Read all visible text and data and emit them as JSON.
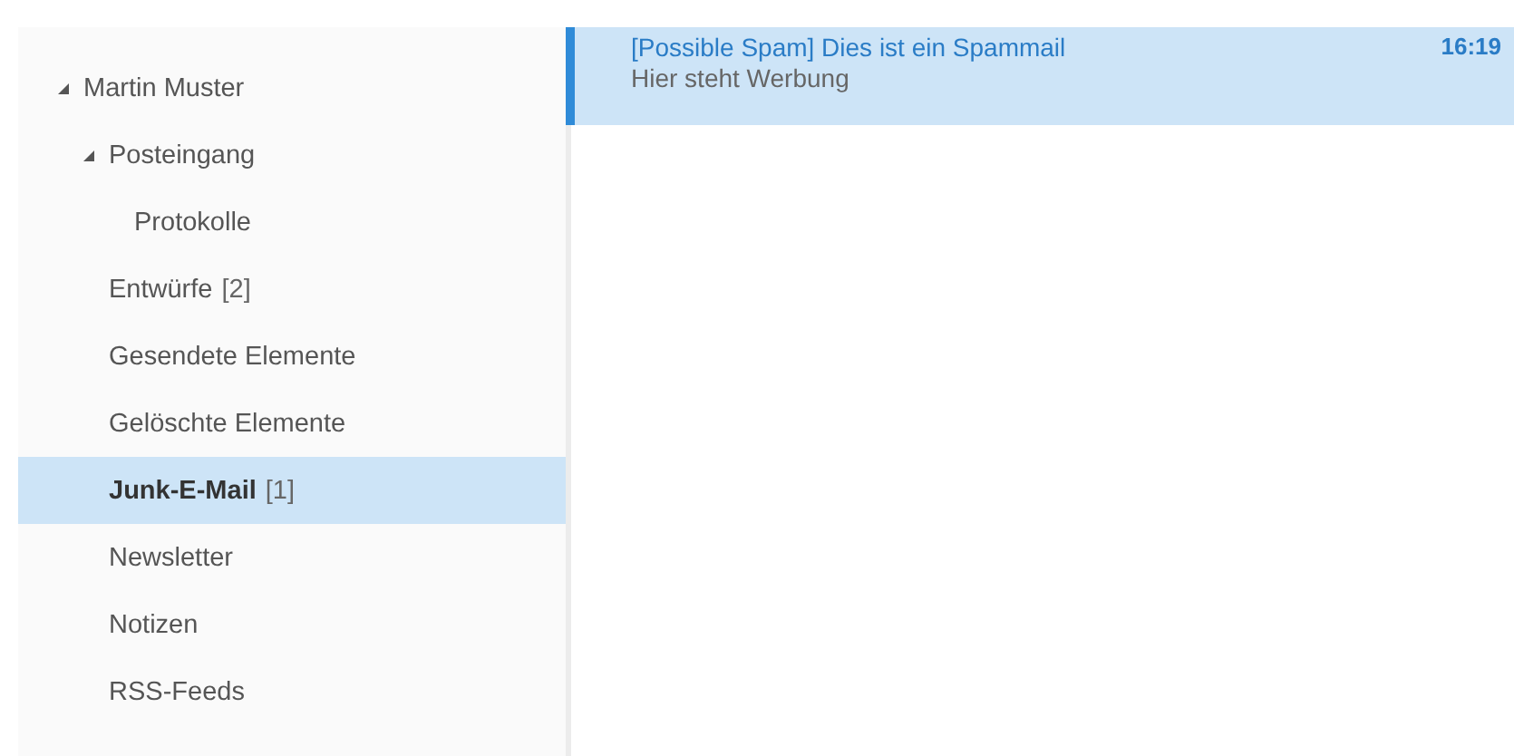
{
  "folders": [
    {
      "label": "Martin Muster",
      "expanded": true,
      "selected": false,
      "children": [
        {
          "label": "Posteingang",
          "expanded": true,
          "selected": false,
          "children": [
            {
              "label": "Protokolle",
              "selected": false
            }
          ]
        },
        {
          "label": "Entwürfe",
          "count": "[2]",
          "selected": false
        },
        {
          "label": "Gesendete Elemente",
          "selected": false
        },
        {
          "label": "Gelöschte Elemente",
          "selected": false
        },
        {
          "label": "Junk-E-Mail",
          "count": "[1]",
          "selected": true
        },
        {
          "label": "Newsletter",
          "selected": false
        },
        {
          "label": "Notizen",
          "selected": false
        },
        {
          "label": "RSS-Feeds",
          "selected": false
        }
      ]
    }
  ],
  "messages": [
    {
      "subject": "[Possible Spam] Dies ist ein Spammail",
      "preview": "Hier steht Werbung",
      "time": "16:19",
      "selected": true
    }
  ]
}
